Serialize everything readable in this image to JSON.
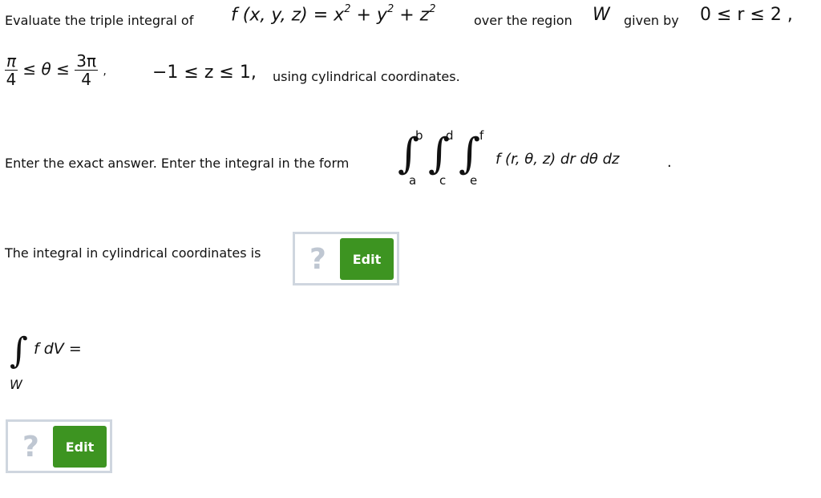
{
  "problem": {
    "line1": {
      "prefix": "Evaluate the triple integral of",
      "function": "f (x, y, z) = x",
      "exp1": "2",
      "plus_y": " + y",
      "exp2": "2",
      "plus_z": " + z",
      "exp3": "2",
      "region_text": "over the region",
      "region_symbol": "W",
      "given_by": "given by",
      "r_bounds": "0 ≤ r ≤ 2 ,"
    },
    "line2": {
      "theta_low_num": "π",
      "theta_low_den": "4",
      "theta_mid": "≤ θ ≤",
      "theta_high_num": "3π",
      "theta_high_den": "4",
      "comma": ",",
      "z_bounds": "−1 ≤ z ≤ 1,",
      "suffix": "using cylindrical coordinates."
    },
    "instruction": {
      "text": "Enter the exact answer. Enter the integral in the form",
      "outer_upper": "b",
      "outer_lower": "a",
      "middle_upper": "d",
      "middle_lower": "c",
      "inner_upper": "f",
      "inner_lower": "e",
      "integrand": "f (r, θ, z) dr dθ dz",
      "period": "."
    },
    "cylindrical_prompt": "The integral in cylindrical coordinates is",
    "result_expr": "f dV =",
    "result_region": "W"
  },
  "answer_fields": [
    {
      "placeholder_icon": "?",
      "button_label": "Edit"
    },
    {
      "placeholder_icon": "?",
      "button_label": "Edit"
    }
  ],
  "colors": {
    "edit_button": "#3d9421",
    "box_border": "#cfd6df",
    "question_mark": "#bfc7d2"
  }
}
